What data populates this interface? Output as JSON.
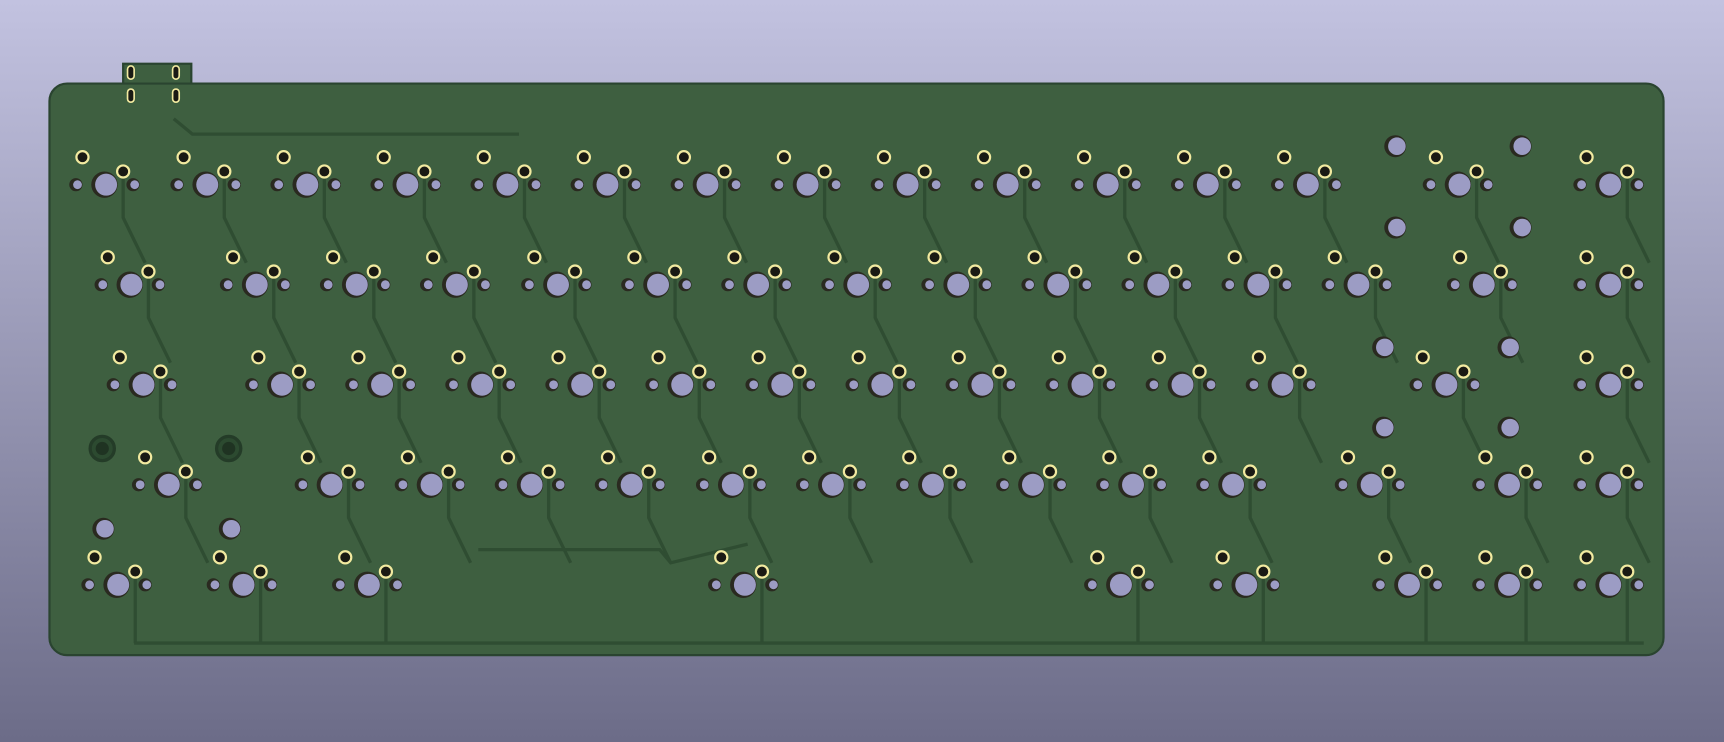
{
  "viewer": {
    "background_top": "#c2c2e0",
    "background_bottom": "#6c6c88"
  },
  "board": {
    "substrate_color": "#3e5f40",
    "trace_color": "#2f4d32",
    "edge_color": "#2a4430",
    "pad_ring_color": "#f2eaa0",
    "hole_color": "#9c9cc4",
    "switch_rows": [
      15,
      15,
      14,
      14,
      9
    ]
  }
}
